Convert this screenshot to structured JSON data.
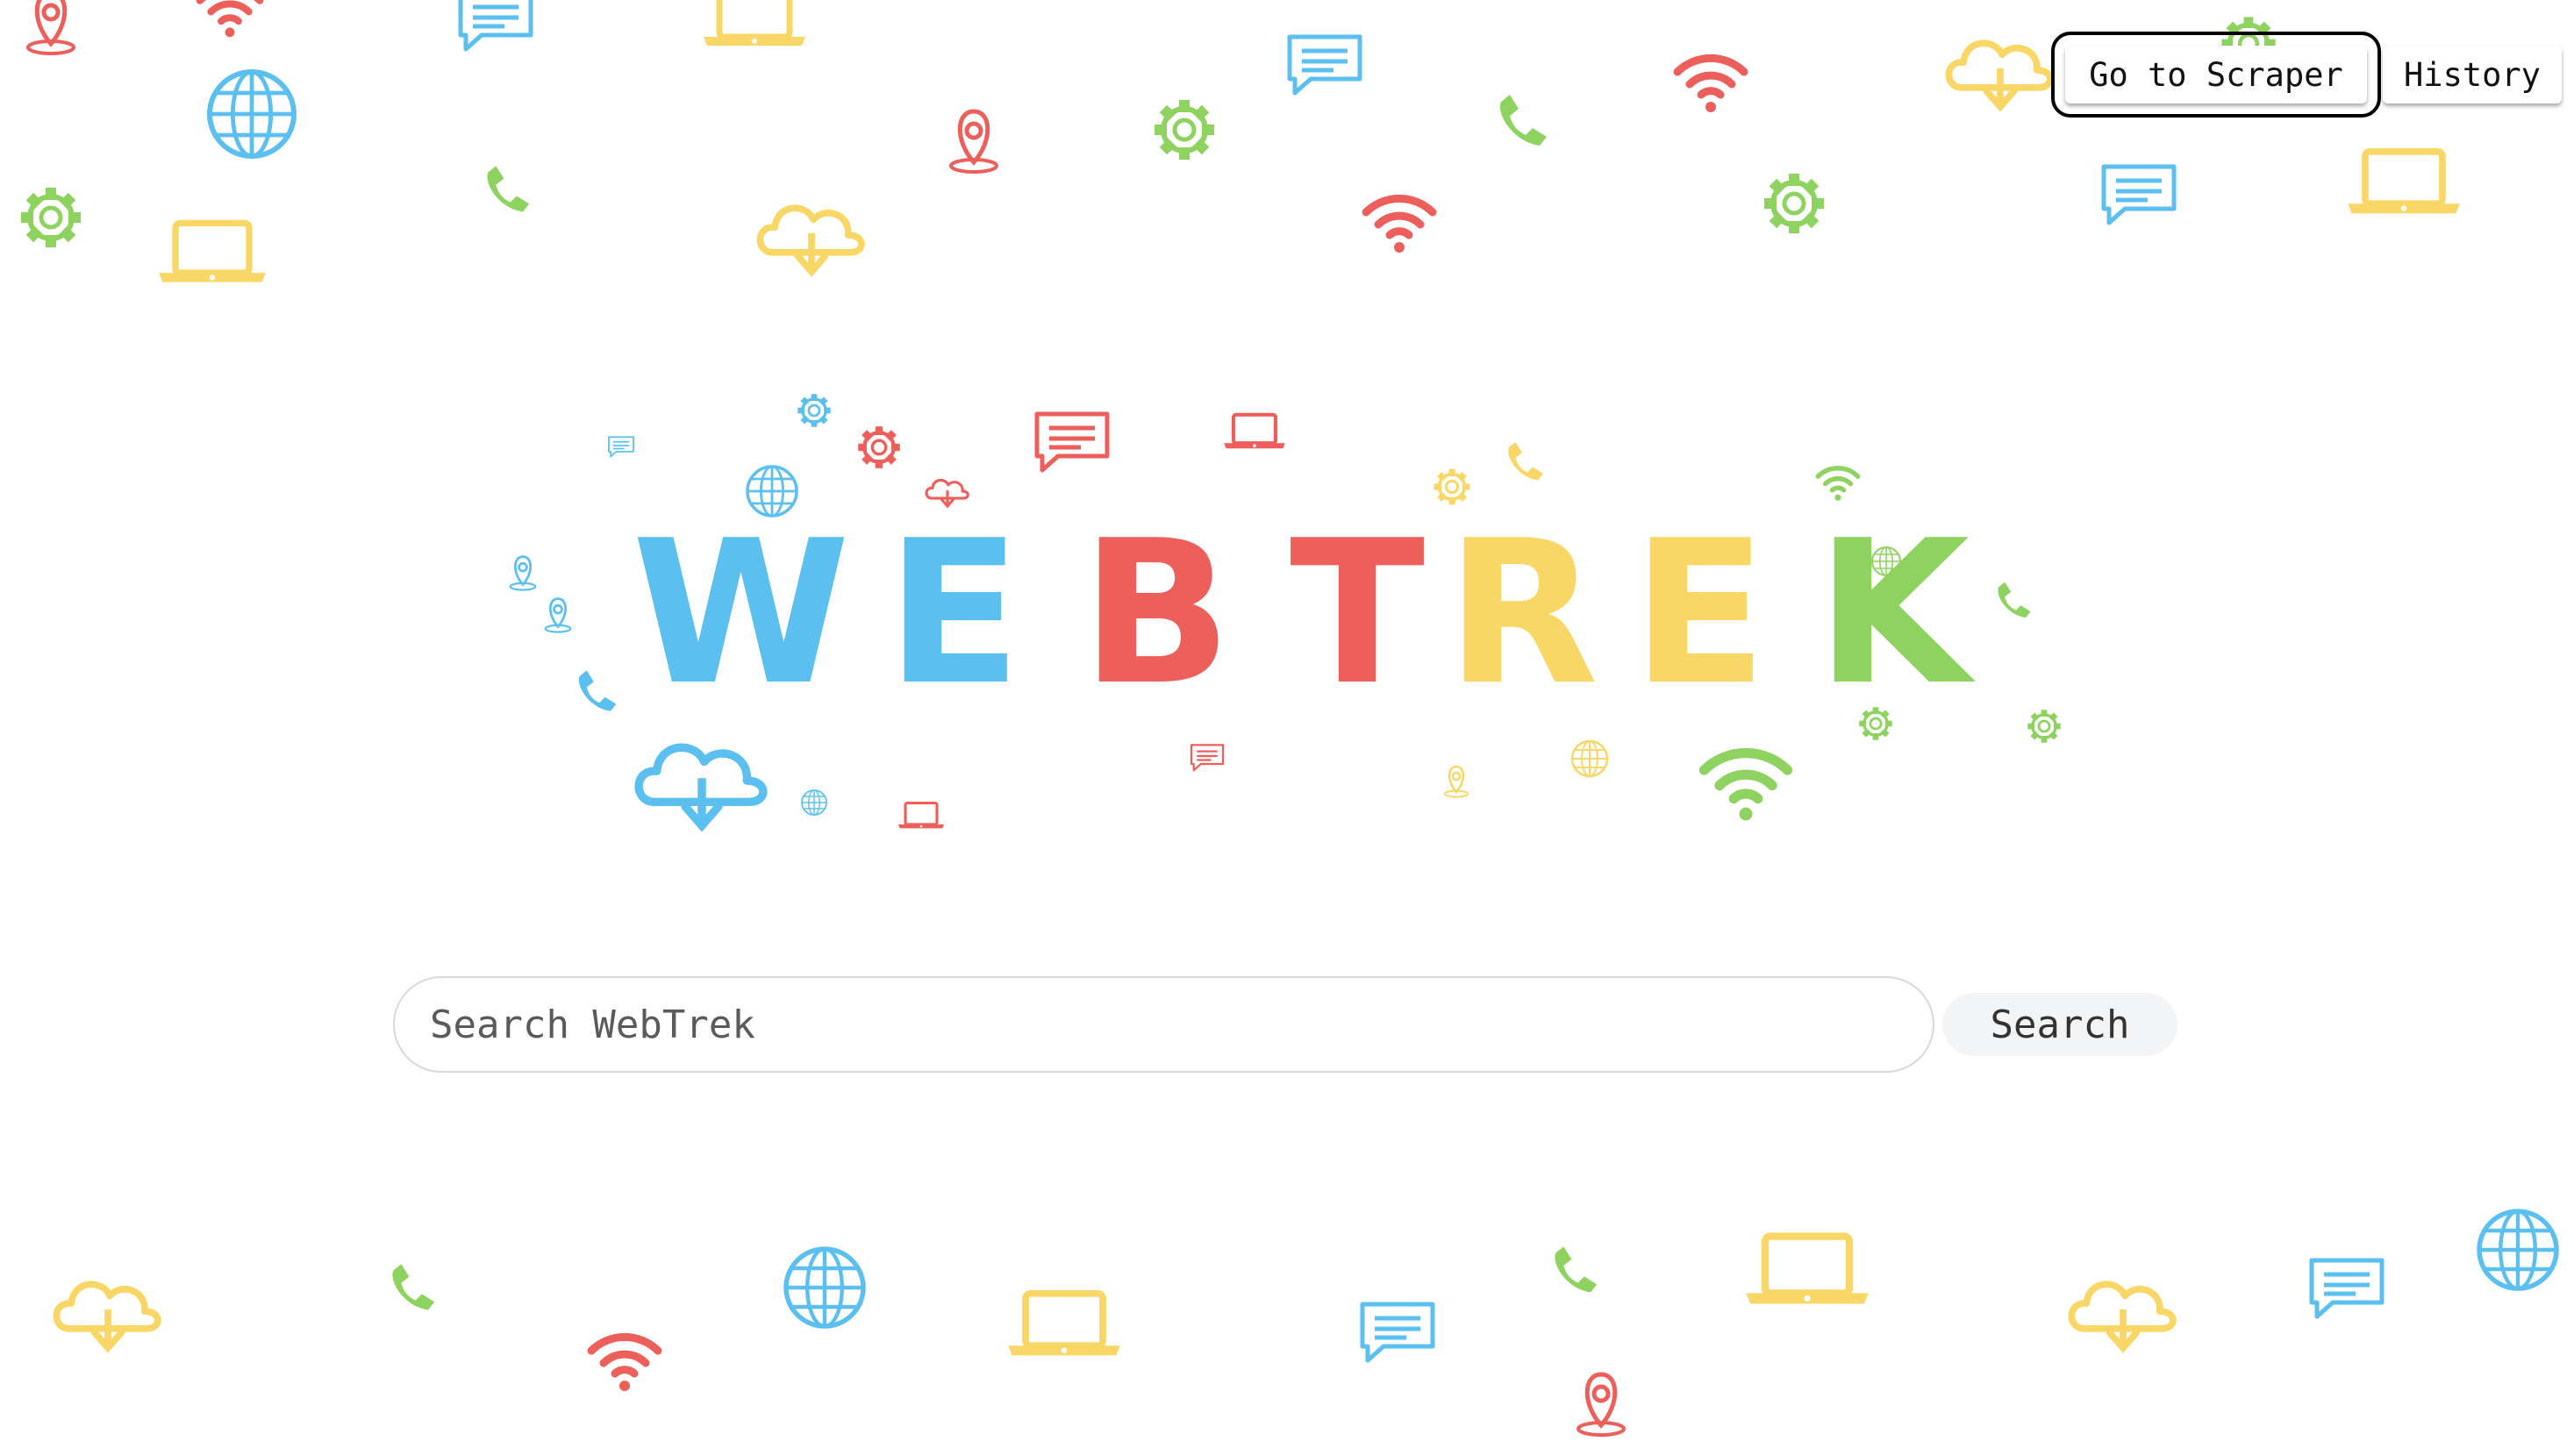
{
  "header": {
    "scraper_label": "Go to Scraper",
    "history_label": "History"
  },
  "logo": {
    "letters": [
      {
        "char": "W",
        "color": "#5bc0f0"
      },
      {
        "char": "E",
        "color": "#5bc0f0"
      },
      {
        "char": "B",
        "color": "#ec5f5a"
      },
      {
        "char": "T",
        "color": "#ec5f5a"
      },
      {
        "char": "R",
        "color": "#f9d766"
      },
      {
        "char": "E",
        "color": "#f9d766"
      },
      {
        "char": "K",
        "color": "#8ed35f"
      }
    ]
  },
  "search": {
    "placeholder": "Search WebTrek",
    "value": "",
    "button_label": "Search"
  },
  "colors": {
    "blue": "#5bc0f0",
    "red": "#ec5f5a",
    "yellow": "#f9d766",
    "green": "#8ed35f"
  },
  "background_icons": [
    "map-pin-icon",
    "wifi-icon",
    "chat-icon",
    "laptop-icon",
    "chat-icon",
    "phone-icon",
    "wifi-icon",
    "cloud-download-icon",
    "gear-icon",
    "globe-icon",
    "map-pin-icon",
    "gear-icon",
    "phone-icon",
    "gear-icon",
    "chat-icon",
    "laptop-icon",
    "gear-icon",
    "laptop-icon",
    "cloud-download-icon",
    "wifi-icon",
    "cloud-download-icon",
    "phone-icon",
    "globe-icon",
    "laptop-icon",
    "chat-icon",
    "wifi-icon",
    "phone-icon",
    "map-pin-icon",
    "laptop-icon",
    "cloud-download-icon",
    "chat-icon",
    "globe-icon"
  ]
}
